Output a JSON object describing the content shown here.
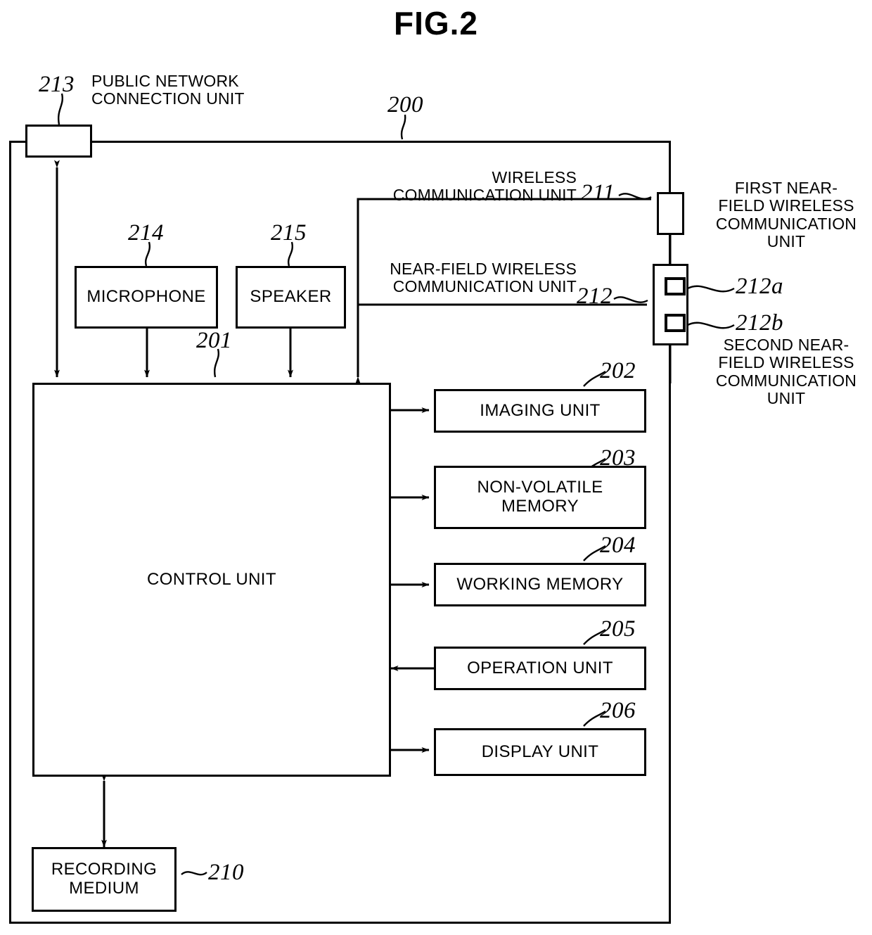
{
  "figure": {
    "title": "FIG.2",
    "system_ref": "200"
  },
  "blocks": {
    "public_network_connection_unit": {
      "ref": "213",
      "label": "PUBLIC NETWORK\nCONNECTION UNIT"
    },
    "microphone": {
      "ref": "214",
      "label": "MICROPHONE"
    },
    "speaker": {
      "ref": "215",
      "label": "SPEAKER"
    },
    "control_unit": {
      "ref": "201",
      "label": "CONTROL UNIT"
    },
    "imaging_unit": {
      "ref": "202",
      "label": "IMAGING UNIT"
    },
    "non_volatile_memory": {
      "ref": "203",
      "label": "NON-VOLATILE MEMORY"
    },
    "working_memory": {
      "ref": "204",
      "label": "WORKING MEMORY"
    },
    "operation_unit": {
      "ref": "205",
      "label": "OPERATION UNIT"
    },
    "display_unit": {
      "ref": "206",
      "label": "DISPLAY UNIT"
    },
    "recording_medium": {
      "ref": "210",
      "label": "RECORDING MEDIUM"
    },
    "wireless_communication_unit": {
      "ref": "211",
      "label": "WIRELESS COMMUNICATION UNIT"
    },
    "near_field_wireless_communication_unit": {
      "ref": "212",
      "label": "NEAR-FIELD WIRELESS COMMUNICATION UNIT"
    },
    "first_near_field": {
      "ref": "212a",
      "label": "FIRST NEAR-FIELD WIRELESS COMMUNICATION UNIT"
    },
    "second_near_field": {
      "ref": "212b",
      "label": "SECOND NEAR-FIELD WIRELESS COMMUNICATION UNIT"
    }
  },
  "labels": {
    "public_network_l1": "PUBLIC NETWORK",
    "public_network_l2": "CONNECTION UNIT",
    "wireless_l1": "WIRELESS",
    "wireless_l2": "COMMUNICATION UNIT",
    "nearfield_l1": "NEAR-FIELD WIRELESS",
    "nearfield_l2": "COMMUNICATION UNIT",
    "first_nf_l1": "FIRST NEAR-",
    "first_nf_l2": "FIELD WIRELESS",
    "first_nf_l3": "COMMUNICATION",
    "first_nf_l4": "UNIT",
    "second_nf_l1": "SECOND NEAR-",
    "second_nf_l2": "FIELD WIRELESS",
    "second_nf_l3": "COMMUNICATION",
    "second_nf_l4": "UNIT",
    "microphone": "MICROPHONE",
    "speaker": "SPEAKER",
    "control_unit": "CONTROL UNIT",
    "imaging_unit": "IMAGING UNIT",
    "nvm_l1": "NON-VOLATILE",
    "nvm_l2": "MEMORY",
    "working_memory": "WORKING MEMORY",
    "operation_unit": "OPERATION UNIT",
    "display_unit": "DISPLAY UNIT",
    "recording_l1": "RECORDING",
    "recording_l2": "MEDIUM"
  },
  "refs": {
    "r200": "200",
    "r201": "201",
    "r202": "202",
    "r203": "203",
    "r204": "204",
    "r205": "205",
    "r206": "206",
    "r210": "210",
    "r211": "211",
    "r212": "212",
    "r212a": "212a",
    "r212b": "212b",
    "r213": "213",
    "r214": "214",
    "r215": "215"
  },
  "colors": {
    "line": "#000000",
    "background": "#ffffff"
  }
}
